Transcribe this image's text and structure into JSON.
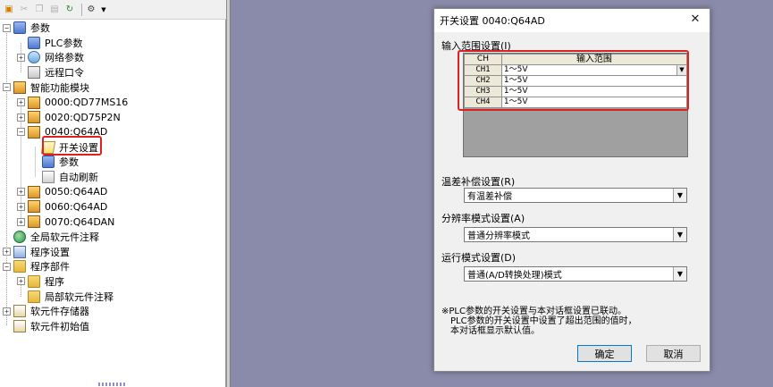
{
  "tree": {
    "items": [
      {
        "label": "参数",
        "expander": "−",
        "icon": "parameter-folder-icon"
      },
      {
        "label": "PLC参数",
        "expander": "",
        "icon": "plc-parameter-icon"
      },
      {
        "label": "网络参数",
        "expander": "+",
        "icon": "network-parameter-icon"
      },
      {
        "label": "远程口令",
        "expander": "",
        "icon": "remote-password-icon"
      },
      {
        "label": "智能功能模块",
        "expander": "−",
        "icon": "intelligent-module-folder-icon"
      },
      {
        "label": "0000:QD77MS16",
        "expander": "+",
        "icon": "module-icon"
      },
      {
        "label": "0020:QD75P2N",
        "expander": "+",
        "icon": "module-icon"
      },
      {
        "label": "0040:Q64AD",
        "expander": "−",
        "icon": "module-icon"
      },
      {
        "label": "开关设置",
        "expander": "",
        "icon": "switch-setting-icon"
      },
      {
        "label": "参数",
        "expander": "",
        "icon": "parameter-icon"
      },
      {
        "label": "自动刷新",
        "expander": "",
        "icon": "auto-refresh-icon"
      },
      {
        "label": "0050:Q64AD",
        "expander": "+",
        "icon": "module-icon"
      },
      {
        "label": "0060:Q64AD",
        "expander": "+",
        "icon": "module-icon"
      },
      {
        "label": "0070:Q64DAN",
        "expander": "+",
        "icon": "module-icon"
      },
      {
        "label": "全局软元件注释",
        "expander": "",
        "icon": "global-comment-icon"
      },
      {
        "label": "程序设置",
        "expander": "+",
        "icon": "program-setting-icon"
      },
      {
        "label": "程序部件",
        "expander": "−",
        "icon": "program-parts-folder-icon"
      },
      {
        "label": "程序",
        "expander": "+",
        "icon": "program-folder-icon"
      },
      {
        "label": "局部软元件注释",
        "expander": "",
        "icon": "local-comment-icon"
      },
      {
        "label": "软元件存储器",
        "expander": "+",
        "icon": "device-memory-icon"
      },
      {
        "label": "软元件初始值",
        "expander": "",
        "icon": "device-init-icon"
      }
    ]
  },
  "dialog": {
    "title": "开关设置 0040:Q64AD",
    "close_glyph": "✕",
    "input_range_label": "输入范围设置(I)",
    "table": {
      "col_ch": "CH",
      "col_range": "输入范围",
      "rows": [
        {
          "ch": "CH1",
          "range": "1～5V"
        },
        {
          "ch": "CH2",
          "range": "1～5V"
        },
        {
          "ch": "CH3",
          "range": "1～5V"
        },
        {
          "ch": "CH4",
          "range": "1～5V"
        }
      ]
    },
    "temp_comp_label": "温差补偿设置(R)",
    "temp_comp_value": "有温差补偿",
    "resolution_label": "分辨率模式设置(A)",
    "resolution_value": "普通分辨率模式",
    "run_mode_label": "运行模式设置(D)",
    "run_mode_value": "普通(A/D转换处理)模式",
    "note_lines": [
      "※PLC参数的开关设置与本对话框设置已联动。",
      "PLC参数的开关设置中设置了超出范围的值时，",
      "本对话框显示默认值。"
    ],
    "ok_label": "确定",
    "cancel_label": "取消"
  },
  "colors": {
    "highlight": "#e02020",
    "workspace": "#8a8aaa"
  }
}
